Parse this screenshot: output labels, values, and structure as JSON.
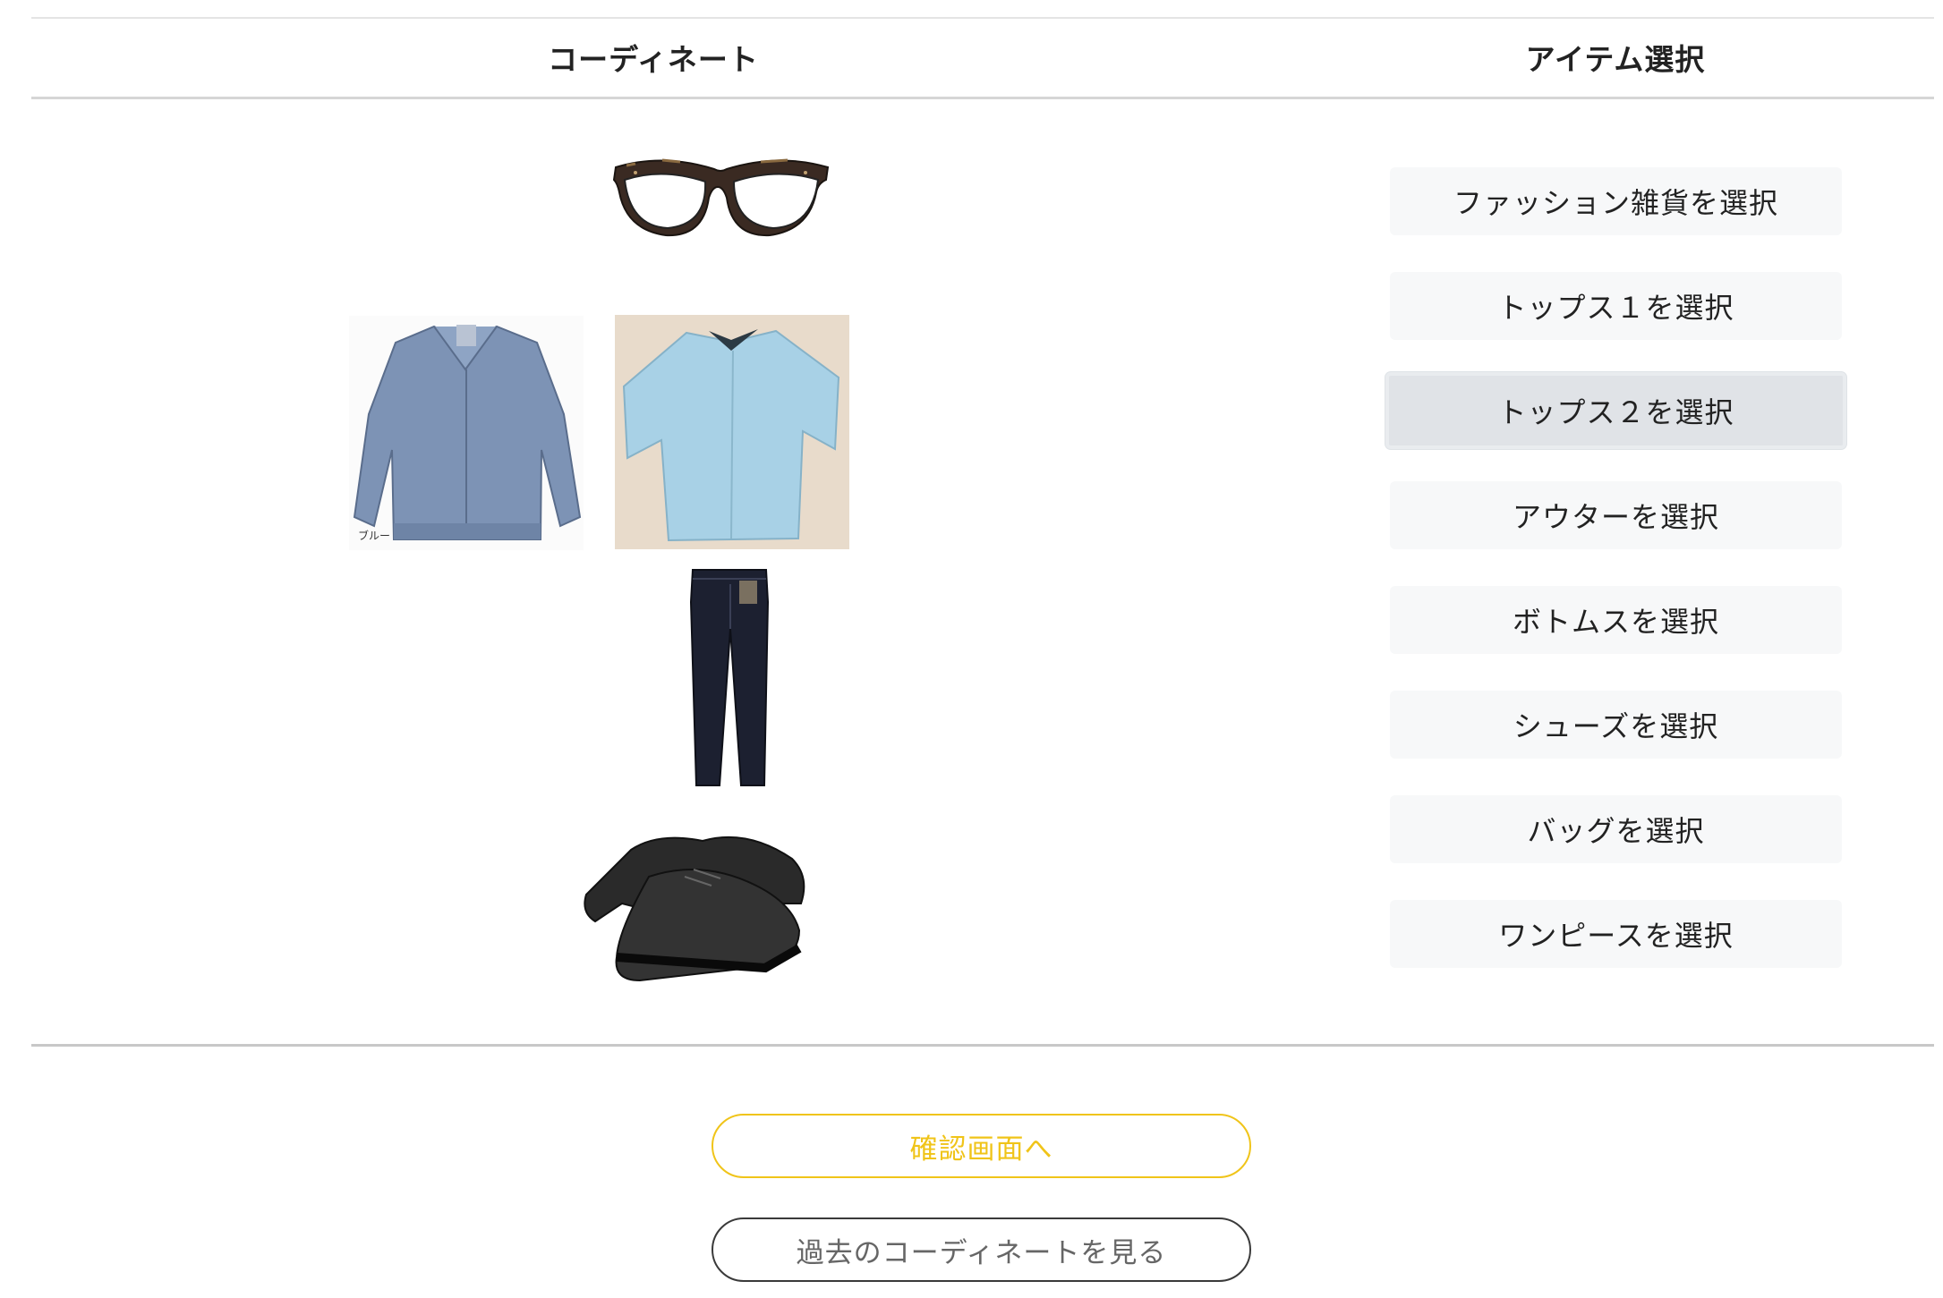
{
  "columns": {
    "coordinate_title": "コーディネート",
    "item_select_title": "アイテム選択"
  },
  "outfit": {
    "jacket_caption": "ブルー"
  },
  "menu": {
    "items": [
      {
        "label": "ファッション雑貨を選択"
      },
      {
        "label": "トップス１を選択"
      },
      {
        "label": "トップス２を選択",
        "active": true
      },
      {
        "label": "アウターを選択"
      },
      {
        "label": "ボトムスを選択"
      },
      {
        "label": "シューズを選択"
      },
      {
        "label": "バッグを選択"
      },
      {
        "label": "ワンピースを選択"
      }
    ]
  },
  "actions": {
    "confirm_label": "確認画面へ",
    "history_label": "過去のコーディネートを見る"
  },
  "colors": {
    "accent": "#f0c419",
    "active_button": "#e0e3e7",
    "button_bg": "#f7f8f9"
  }
}
